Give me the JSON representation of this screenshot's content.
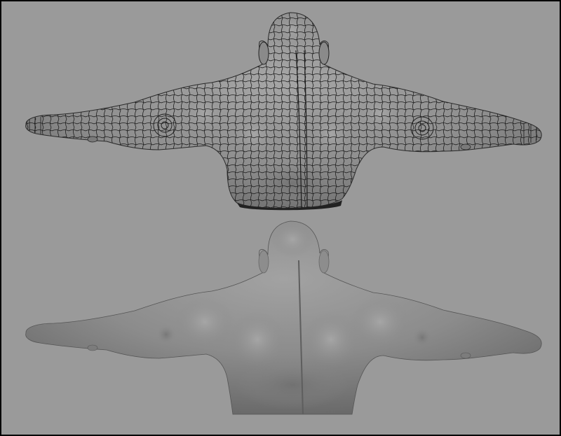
{
  "viewport": {
    "background_color": "#9a9a9a",
    "border_color": "#000000"
  },
  "models": [
    {
      "name": "wireframe-torso-back",
      "display_mode": "wireframe-on-shaded",
      "shade_color": "#8e8e8e",
      "wire_color": "#1a1a1a"
    },
    {
      "name": "smooth-torso-back",
      "display_mode": "smooth-shaded",
      "shade_color": "#8a8a8a"
    }
  ]
}
